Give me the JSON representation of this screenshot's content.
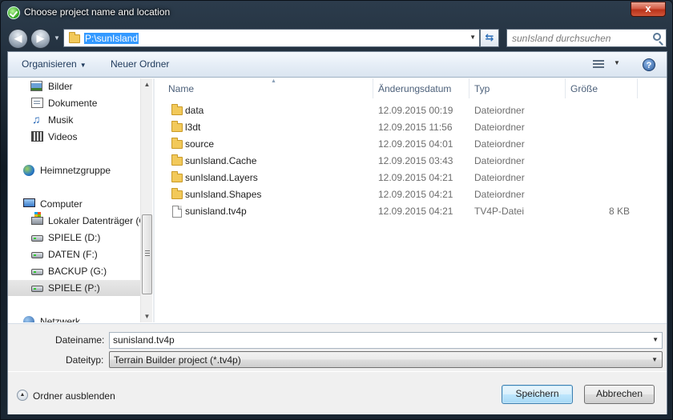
{
  "window": {
    "title": "Choose project name and location",
    "close_label": "x"
  },
  "navigation": {
    "address": "P:\\sunIsland",
    "search_placeholder": "sunIsland durchsuchen"
  },
  "toolbar": {
    "organize_label": "Organisieren",
    "new_folder_label": "Neuer Ordner"
  },
  "sidebar": {
    "items": [
      {
        "label": "Bilder",
        "icon": "pictures-icon"
      },
      {
        "label": "Dokumente",
        "icon": "documents-icon"
      },
      {
        "label": "Musik",
        "icon": "music-icon"
      },
      {
        "label": "Videos",
        "icon": "videos-icon"
      },
      {
        "label": "Heimnetzgruppe",
        "icon": "homegroup-icon"
      },
      {
        "label": "Computer",
        "icon": "computer-icon"
      },
      {
        "label": "Lokaler Datenträger (C",
        "icon": "local-disk-icon"
      },
      {
        "label": "SPIELE (D:)",
        "icon": "drive-icon"
      },
      {
        "label": "DATEN (F:)",
        "icon": "drive-icon"
      },
      {
        "label": "BACKUP (G:)",
        "icon": "drive-icon"
      },
      {
        "label": "SPIELE (P:)",
        "icon": "drive-icon",
        "selected": true
      },
      {
        "label": "Netzwerk",
        "icon": "network-icon"
      }
    ]
  },
  "filelist": {
    "columns": [
      "Name",
      "Änderungsdatum",
      "Typ",
      "Größe"
    ],
    "rows": [
      {
        "name": "data",
        "date": "12.09.2015 00:19",
        "type": "Dateiordner",
        "size": "",
        "icon": "folder-icon"
      },
      {
        "name": "l3dt",
        "date": "12.09.2015 11:56",
        "type": "Dateiordner",
        "size": "",
        "icon": "folder-icon"
      },
      {
        "name": "source",
        "date": "12.09.2015 04:01",
        "type": "Dateiordner",
        "size": "",
        "icon": "folder-icon"
      },
      {
        "name": "sunIsland.Cache",
        "date": "12.09.2015 03:43",
        "type": "Dateiordner",
        "size": "",
        "icon": "folder-icon"
      },
      {
        "name": "sunIsland.Layers",
        "date": "12.09.2015 04:21",
        "type": "Dateiordner",
        "size": "",
        "icon": "folder-icon"
      },
      {
        "name": "sunIsland.Shapes",
        "date": "12.09.2015 04:21",
        "type": "Dateiordner",
        "size": "",
        "icon": "folder-icon"
      },
      {
        "name": "sunisland.tv4p",
        "date": "12.09.2015 04:21",
        "type": "TV4P-Datei",
        "size": "8 KB",
        "icon": "file-icon"
      }
    ]
  },
  "fields": {
    "filename_label": "Dateiname:",
    "filename_value": "sunisland.tv4p",
    "filetype_label": "Dateityp:",
    "filetype_value": "Terrain Builder project (*.tv4p)"
  },
  "footer": {
    "hide_folders_label": "Ordner ausblenden",
    "save_label": "Speichern",
    "cancel_label": "Abbrechen"
  }
}
